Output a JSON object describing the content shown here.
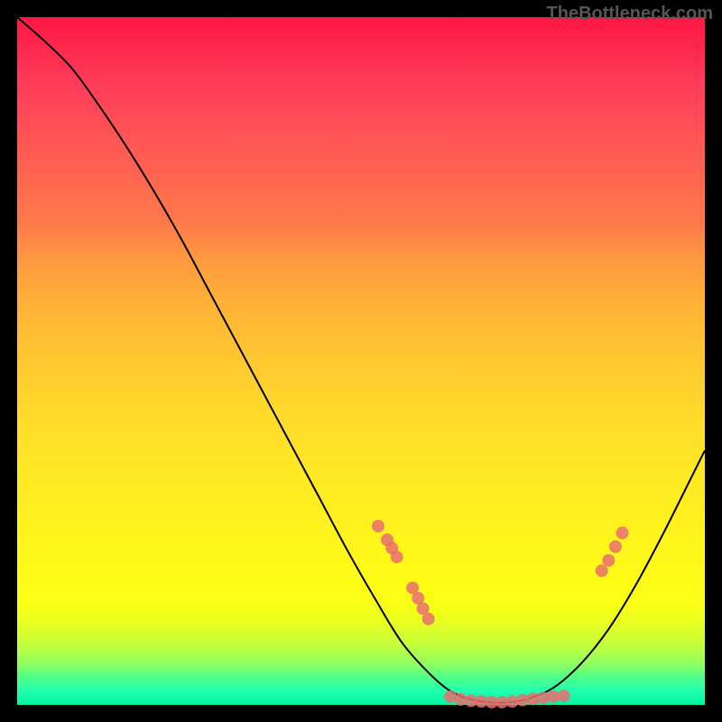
{
  "watermark": "TheBottleneck.com",
  "chart_data": {
    "type": "line",
    "title": "",
    "xlabel": "",
    "ylabel": "",
    "xlim": [
      0,
      100
    ],
    "ylim": [
      0,
      100
    ],
    "curve": [
      {
        "x": 0.0,
        "y": 100.0
      },
      {
        "x": 4.0,
        "y": 96.5
      },
      {
        "x": 8.0,
        "y": 92.5
      },
      {
        "x": 12.0,
        "y": 87.0
      },
      {
        "x": 16.0,
        "y": 81.0
      },
      {
        "x": 20.0,
        "y": 74.5
      },
      {
        "x": 24.0,
        "y": 67.5
      },
      {
        "x": 28.0,
        "y": 60.0
      },
      {
        "x": 32.0,
        "y": 52.5
      },
      {
        "x": 36.0,
        "y": 45.0
      },
      {
        "x": 40.0,
        "y": 37.5
      },
      {
        "x": 44.0,
        "y": 30.0
      },
      {
        "x": 48.0,
        "y": 22.5
      },
      {
        "x": 52.0,
        "y": 15.5
      },
      {
        "x": 56.0,
        "y": 9.0
      },
      {
        "x": 60.0,
        "y": 4.5
      },
      {
        "x": 63.0,
        "y": 2.0
      },
      {
        "x": 66.0,
        "y": 0.8
      },
      {
        "x": 70.0,
        "y": 0.3
      },
      {
        "x": 74.0,
        "y": 0.8
      },
      {
        "x": 78.0,
        "y": 2.5
      },
      {
        "x": 82.0,
        "y": 6.0
      },
      {
        "x": 86.0,
        "y": 11.0
      },
      {
        "x": 90.0,
        "y": 17.5
      },
      {
        "x": 94.0,
        "y": 25.0
      },
      {
        "x": 98.0,
        "y": 33.0
      },
      {
        "x": 100.0,
        "y": 37.0
      }
    ],
    "markers": [
      {
        "x": 52.5,
        "y": 26.0
      },
      {
        "x": 53.8,
        "y": 24.0
      },
      {
        "x": 54.5,
        "y": 22.8
      },
      {
        "x": 55.2,
        "y": 21.5
      },
      {
        "x": 57.5,
        "y": 17.0
      },
      {
        "x": 58.3,
        "y": 15.5
      },
      {
        "x": 59.0,
        "y": 14.0
      },
      {
        "x": 59.8,
        "y": 12.5
      },
      {
        "x": 63.0,
        "y": 1.2
      },
      {
        "x": 64.5,
        "y": 0.8
      },
      {
        "x": 66.0,
        "y": 0.6
      },
      {
        "x": 67.5,
        "y": 0.5
      },
      {
        "x": 69.0,
        "y": 0.4
      },
      {
        "x": 70.5,
        "y": 0.4
      },
      {
        "x": 72.0,
        "y": 0.5
      },
      {
        "x": 73.5,
        "y": 0.7
      },
      {
        "x": 75.0,
        "y": 0.85
      },
      {
        "x": 76.5,
        "y": 1.0
      },
      {
        "x": 78.0,
        "y": 1.2
      },
      {
        "x": 79.5,
        "y": 1.3
      },
      {
        "x": 85.0,
        "y": 19.5
      },
      {
        "x": 86.0,
        "y": 21.0
      },
      {
        "x": 87.0,
        "y": 23.0
      },
      {
        "x": 88.0,
        "y": 25.0
      }
    ]
  }
}
